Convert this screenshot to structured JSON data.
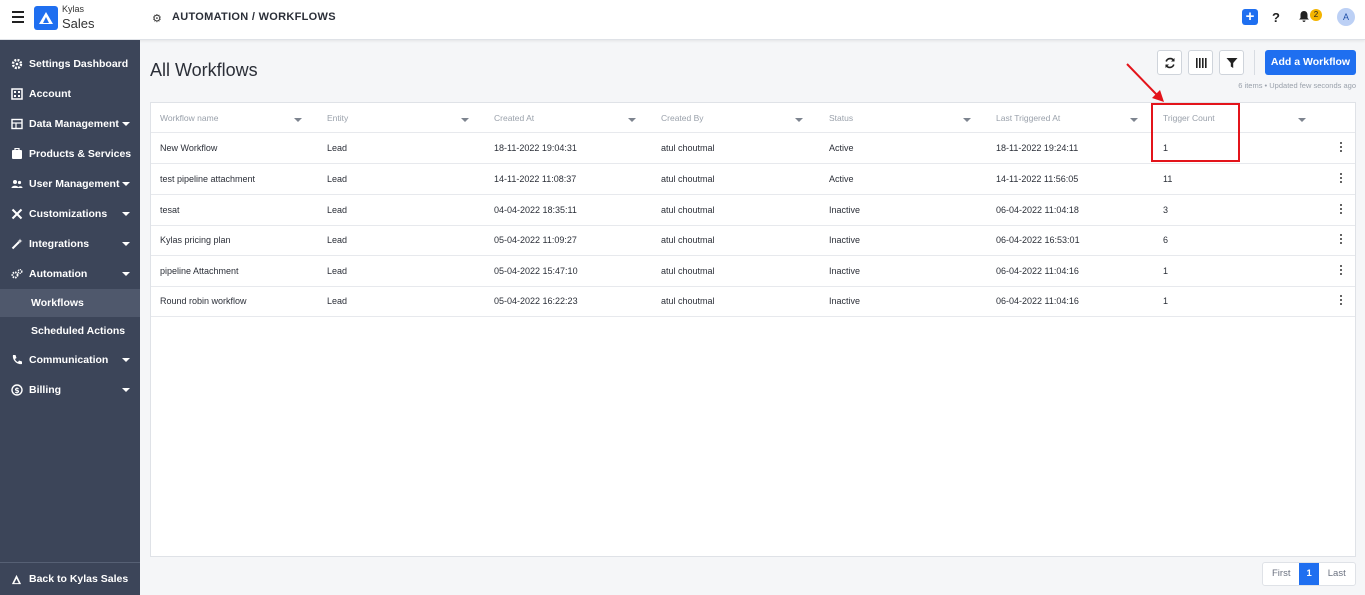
{
  "brand": {
    "top": "Kylas",
    "bottom": "Sales"
  },
  "breadcrumb": "AUTOMATION / WORKFLOWS",
  "header_icons": {
    "plus": "+",
    "help": "?",
    "notifications": "2",
    "avatar": "A"
  },
  "sidebar": {
    "items": [
      {
        "label": "Settings Dashboard",
        "icon": "gear-icon",
        "caret": false
      },
      {
        "label": "Account",
        "icon": "building-icon",
        "caret": false
      },
      {
        "label": "Data Management",
        "icon": "table-icon",
        "caret": true
      },
      {
        "label": "Products & Services",
        "icon": "package-icon",
        "caret": false
      },
      {
        "label": "User Management",
        "icon": "users-icon",
        "caret": true
      },
      {
        "label": "Customizations",
        "icon": "tools-icon",
        "caret": true
      },
      {
        "label": "Integrations",
        "icon": "wand-icon",
        "caret": true
      },
      {
        "label": "Automation",
        "icon": "cogs-icon",
        "caret": true
      }
    ],
    "sub_items": [
      {
        "label": "Workflows",
        "active": true
      },
      {
        "label": "Scheduled Actions",
        "active": false
      }
    ],
    "items_bottom": [
      {
        "label": "Communication",
        "icon": "phone-icon",
        "caret": true
      },
      {
        "label": "Billing",
        "icon": "billing-icon",
        "caret": true
      }
    ],
    "footer": "Back to Kylas Sales"
  },
  "main": {
    "title": "All Workflows",
    "add_button": "Add a Workflow",
    "meta": "6 items • Updated few seconds ago",
    "columns": [
      "Workflow name",
      "Entity",
      "Created At",
      "Created By",
      "Status",
      "Last Triggered At",
      "Trigger Count"
    ],
    "rows": [
      [
        "New Workflow",
        "Lead",
        "18-11-2022 19:04:31",
        "atul choutmal",
        "Active",
        "18-11-2022 19:24:11",
        "1"
      ],
      [
        "test pipeline attachment",
        "Lead",
        "14-11-2022 11:08:37",
        "atul choutmal",
        "Active",
        "14-11-2022 11:56:05",
        "11"
      ],
      [
        "tesat",
        "Lead",
        "04-04-2022 18:35:11",
        "atul choutmal",
        "Inactive",
        "06-04-2022 11:04:18",
        "3"
      ],
      [
        "Kylas pricing plan",
        "Lead",
        "05-04-2022 11:09:27",
        "atul choutmal",
        "Inactive",
        "06-04-2022 16:53:01",
        "6"
      ],
      [
        "pipeline Attachment",
        "Lead",
        "05-04-2022 15:47:10",
        "atul choutmal",
        "Inactive",
        "06-04-2022 11:04:16",
        "1"
      ],
      [
        "Round robin workflow",
        "Lead",
        "05-04-2022 16:22:23",
        "atul choutmal",
        "Inactive",
        "06-04-2022 11:04:16",
        "1"
      ]
    ]
  },
  "pagination": {
    "first": "First",
    "current": "1",
    "last": "Last"
  },
  "colors": {
    "accent": "#1f6ff0",
    "sidebar": "#3c4559",
    "highlight": "#e3141b",
    "badge": "#f4b400"
  }
}
